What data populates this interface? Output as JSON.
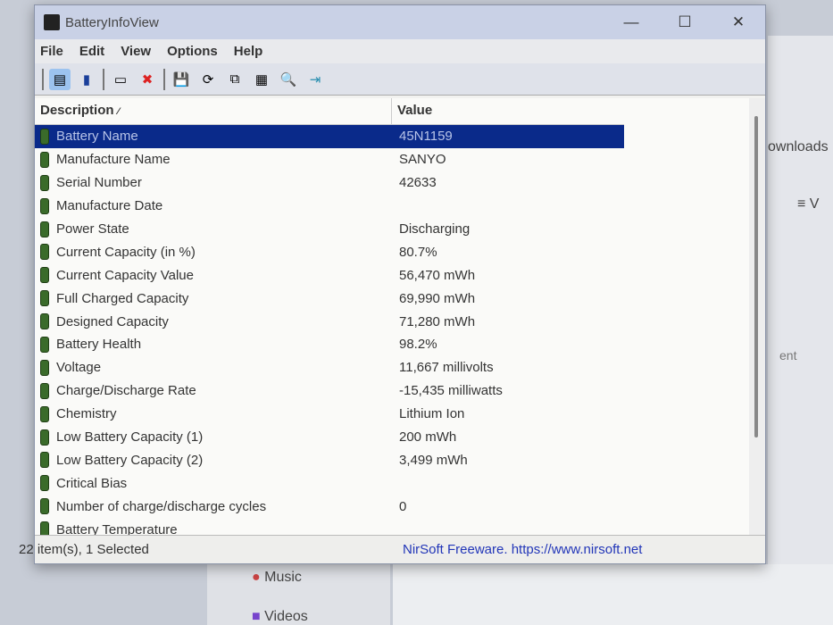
{
  "window": {
    "title": "BatteryInfoView"
  },
  "menu": [
    "File",
    "Edit",
    "View",
    "Options",
    "Help"
  ],
  "columns": {
    "description": "Description",
    "value": "Value"
  },
  "rows": [
    {
      "d": "Battery Name",
      "v": "45N1159"
    },
    {
      "d": "Manufacture Name",
      "v": "SANYO"
    },
    {
      "d": "Serial Number",
      "v": "42633"
    },
    {
      "d": "Manufacture Date",
      "v": ""
    },
    {
      "d": "Power State",
      "v": "Discharging"
    },
    {
      "d": "Current Capacity (in %)",
      "v": "80.7%"
    },
    {
      "d": "Current Capacity Value",
      "v": "56,470 mWh"
    },
    {
      "d": "Full Charged Capacity",
      "v": "69,990 mWh"
    },
    {
      "d": "Designed Capacity",
      "v": "71,280 mWh"
    },
    {
      "d": "Battery Health",
      "v": "98.2%"
    },
    {
      "d": "Voltage",
      "v": "11,667 millivolts"
    },
    {
      "d": "Charge/Discharge Rate",
      "v": "-15,435 milliwatts"
    },
    {
      "d": "Chemistry",
      "v": "Lithium Ion"
    },
    {
      "d": "Low Battery Capacity (1)",
      "v": "200 mWh"
    },
    {
      "d": "Low Battery Capacity (2)",
      "v": "3,499 mWh"
    },
    {
      "d": "Critical Bias",
      "v": ""
    },
    {
      "d": "Number of charge/discharge cycles",
      "v": "0"
    },
    {
      "d": "Battery Temperature",
      "v": ""
    }
  ],
  "status": {
    "count": "22 item(s), 1 Selected",
    "link": "NirSoft Freeware. https://www.nirsoft.net"
  },
  "background": {
    "downloads": "ownloads",
    "view": "≡ V",
    "ent": "ent",
    "music": "Music",
    "videos": "Videos"
  }
}
